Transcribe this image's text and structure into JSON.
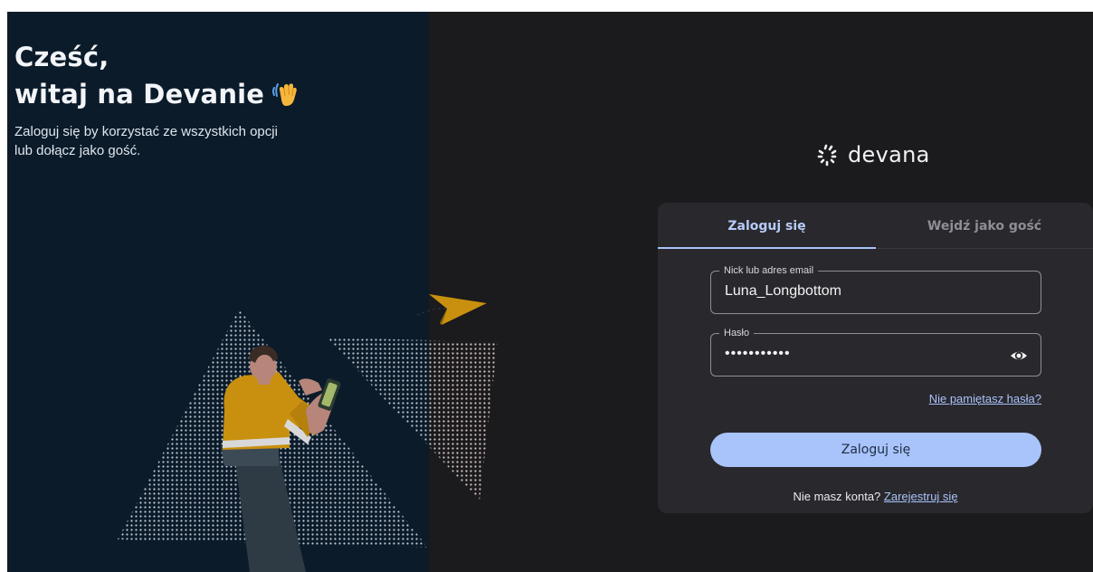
{
  "greeting": {
    "title_line1": "Cześć,",
    "title_line2": "witaj na Devanie",
    "subtitle": "Zaloguj się by korzystać ze wszystkich opcji lub dołącz jako gość."
  },
  "logo": {
    "text": "devana"
  },
  "tabs": [
    {
      "label": "Zaloguj się",
      "active": true
    },
    {
      "label": "Wejdź jako gość",
      "active": false
    }
  ],
  "form": {
    "username": {
      "label": "Nick lub adres email",
      "value": "Luna_Longbottom"
    },
    "password": {
      "label": "Hasło",
      "value": "•••••••••••"
    },
    "forgot_password": "Nie pamiętasz hasła?",
    "submit_label": "Zaloguj się",
    "register_prompt": "Nie masz konta?",
    "register_link": "Zarejestruj się"
  },
  "colors": {
    "left_panel_bg": "#0b1b2a",
    "right_panel_bg": "#1b1a1d",
    "card_bg": "#29282d",
    "accent": "#a8c4fb",
    "illustration_accent": "#c8900e"
  }
}
